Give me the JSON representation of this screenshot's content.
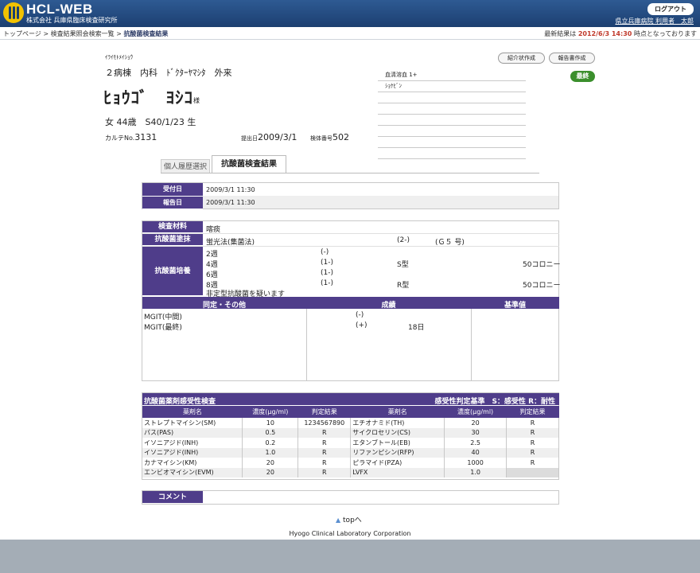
{
  "header": {
    "brand": "HCL-WEB",
    "company": "株式会社 兵庫県臨床検査研究所",
    "logout": "ログアウト",
    "user": "県立兵庫病院 利用者　太郎"
  },
  "breadcrumb": {
    "home": "トップページ",
    "sep1": " > ",
    "list": "検査結果照会検索一覧",
    "sep2": " > ",
    "current": "抗酸菌検査結果"
  },
  "latest": {
    "prefix": "最新結果は ",
    "datetime": "2012/6/3 14:30",
    "suffix": " 時点となっております"
  },
  "buttons": {
    "referral": "紹介状作成",
    "report": "報告書作成"
  },
  "status": "最終",
  "patient": {
    "kana_label": "ｲﾗｲﾓﾄﾒｲｼｮｳ",
    "ward": "２病棟　内科　ﾄﾞｸﾀｰﾔﾏｼﾀ　外来",
    "name": "ﾋｮｳｺﾞ　ﾖｼｺ",
    "honorific": "様",
    "info": "女 44歳　S40/1/23 生",
    "chart_label": "カルテNo.",
    "chart_no": "3131",
    "submit_label": "提出日",
    "submit_date": "2009/3/1",
    "specimen_label": "検体番号",
    "specimen_no": "502"
  },
  "notes": [
    "血清溶血 1+",
    "ｼｮｹﾋﾞﾝ",
    "",
    "",
    "",
    "",
    "",
    ""
  ],
  "tabs": {
    "history": "個人履歴選択",
    "active": "抗酸菌検査結果"
  },
  "dates": {
    "received_label": "受付日",
    "received": "2009/3/1 11:30",
    "report_label": "報告日",
    "report": "2009/3/1 11:30"
  },
  "exam": {
    "material_label": "検査材料",
    "material": "喀痰",
    "smear_label": "抗酸菌塗抹",
    "smear_method": "蛍光法(集菌法)",
    "smear_result": "(2-)",
    "smear_gaffky": "(Ｇ５ 号)",
    "culture_label": "抗酸菌培養",
    "culture": [
      {
        "week": "2週",
        "result": "(-)",
        "type": "",
        "count": ""
      },
      {
        "week": "4週",
        "result": "(1-)",
        "type": "S型",
        "count": "50コロニー"
      },
      {
        "week": "6週",
        "result": "(1-)",
        "type": "",
        "count": ""
      },
      {
        "week": "8週",
        "result": "(1-)",
        "type": "R型",
        "count": "50コロニー"
      }
    ],
    "culture_note": "非定型抗酸菌を疑います",
    "id_headers": [
      "同定・その他",
      "成績",
      "基準値"
    ],
    "id_rows": [
      {
        "name": "MGIT(中間)",
        "result": "(-)",
        "days": ""
      },
      {
        "name": "MGIT(最終)",
        "result": "(+)",
        "days": "18日"
      },
      {
        "name": "",
        "result": "",
        "days": ""
      },
      {
        "name": "",
        "result": "",
        "days": ""
      },
      {
        "name": "",
        "result": "",
        "days": ""
      },
      {
        "name": "",
        "result": "",
        "days": ""
      }
    ]
  },
  "susceptibility": {
    "title": "抗酸菌薬剤感受性検査",
    "criteria": "感受性判定基準　S：感受性 R：耐性",
    "headers": [
      "薬剤名",
      "濃度(μg/ml)",
      "判定結果",
      "薬剤名",
      "濃度(μg/ml)",
      "判定結果"
    ],
    "rows": [
      [
        "ストレプトマイシン(SM)",
        "10",
        "1234567890",
        "エチオナミド(TH)",
        "20",
        "R"
      ],
      [
        "パス(PAS)",
        "0.5",
        "R",
        "サイクロセリン(CS)",
        "30",
        "R"
      ],
      [
        "イソニアジド(INH)",
        "0.2",
        "R",
        "エタンブトール(EB)",
        "2.5",
        "R"
      ],
      [
        "イソニアジド(INH)",
        "1.0",
        "R",
        "リファンピシン(RFP)",
        "40",
        "R"
      ],
      [
        "カナマイシン(KM)",
        "20",
        "R",
        "ピラマイド(PZA)",
        "1000",
        "R"
      ],
      [
        "エンビオマイシン(EVM)",
        "20",
        "R",
        "LVFX",
        "1.0",
        ""
      ]
    ]
  },
  "comment_label": "コメント",
  "top_link": "topへ",
  "footer": "Hyogo Clinical Laboratory Corporation",
  "colors": {
    "header": "#1c3f70",
    "label": "#4f3d8a",
    "final": "#3b8f2c",
    "alert": "#c0392b"
  }
}
